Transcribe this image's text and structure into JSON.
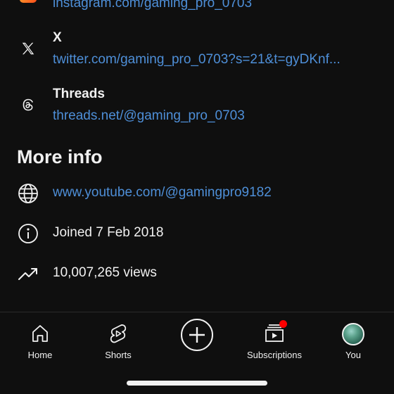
{
  "links": [
    {
      "title": "",
      "url": "instagram.com/gaming_pro_0703",
      "icon": "instagram-icon"
    },
    {
      "title": "X",
      "url": "twitter.com/gaming_pro_0703?s=21&t=gyDKnf...",
      "icon": "x-icon"
    },
    {
      "title": "Threads",
      "url": "threads.net/@gaming_pro_0703",
      "icon": "threads-icon"
    }
  ],
  "more_info": {
    "title": "More info",
    "website": "www.youtube.com/@gamingpro9182",
    "joined": "Joined 7 Feb 2018",
    "views": "10,007,265 views"
  },
  "nav": {
    "home": "Home",
    "shorts": "Shorts",
    "create": "create-icon",
    "subscriptions": "Subscriptions",
    "you": "You"
  },
  "colors": {
    "background": "#0f0f0f",
    "link": "#4e8fd8",
    "text": "#f1f1f1",
    "notification": "#ff0000"
  }
}
